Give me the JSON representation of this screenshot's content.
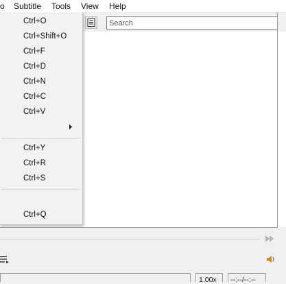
{
  "menubar": {
    "items": [
      {
        "label": "o"
      },
      {
        "label": "Subtitle"
      },
      {
        "label": "Tools"
      },
      {
        "label": "View"
      },
      {
        "label": "Help"
      }
    ]
  },
  "search": {
    "placeholder": "Search"
  },
  "dropdown": {
    "items": [
      {
        "shortcut": "Ctrl+O"
      },
      {
        "shortcut": "Ctrl+Shift+O"
      },
      {
        "shortcut": "Ctrl+F"
      },
      {
        "shortcut": "Ctrl+D"
      },
      {
        "shortcut": "Ctrl+N"
      },
      {
        "shortcut": "Ctrl+C"
      },
      {
        "shortcut": "Ctrl+V"
      },
      {
        "shortcut": "",
        "submenu": true
      },
      {
        "shortcut": "Ctrl+Y"
      },
      {
        "shortcut": "Ctrl+R"
      },
      {
        "shortcut": "Ctrl+S"
      },
      {
        "shortcut": ""
      },
      {
        "shortcut": "Ctrl+Q"
      }
    ]
  },
  "status": {
    "speed": "1.00x",
    "time": "--:--/--:--"
  },
  "icons": {
    "toolbar": "list-view-icon",
    "skip": "skip-forward-icon",
    "playlist": "playlist-icon",
    "volume": "volume-icon"
  }
}
